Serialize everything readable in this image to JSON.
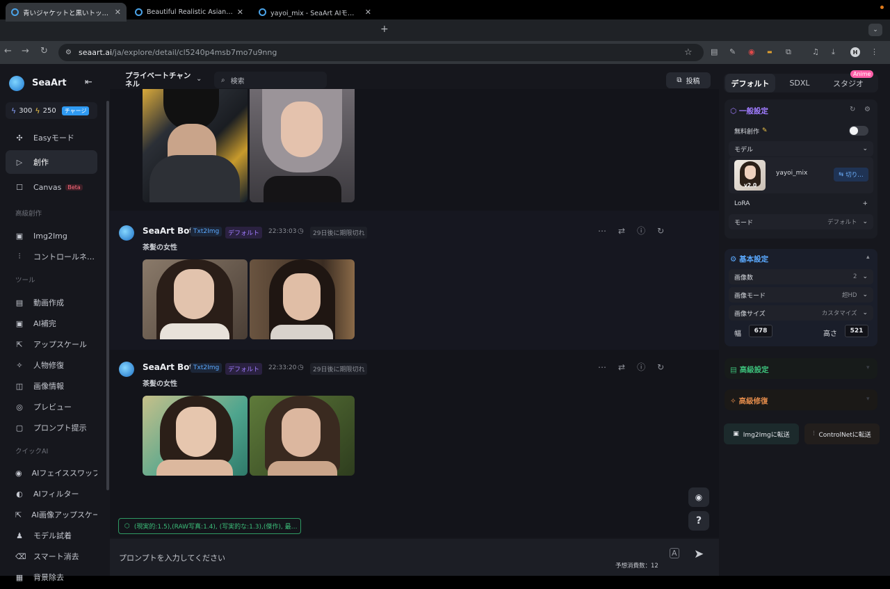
{
  "browser": {
    "tabs": [
      {
        "title": "青いジャケットと黒いトップスを…",
        "active": true
      },
      {
        "title": "Beautiful Realistic Asians - Se…",
        "active": false
      },
      {
        "title": "yayoi_mix - SeaArt AIモデル",
        "active": false
      }
    ],
    "url_domain": "seaart.ai",
    "url_path": "/ja/explore/detail/cl5240p4msb7mo7u9nng",
    "new_tab": "+",
    "profile_initial": "H"
  },
  "sidebar": {
    "brand": "SeaArt",
    "credits": {
      "a": "300",
      "b": "250",
      "charge": "チャージ"
    },
    "items_top": [
      {
        "label": "Easyモード",
        "icon": "✣",
        "name": "sidebar-item-easy-mode"
      },
      {
        "label": "創作",
        "icon": "▷",
        "name": "sidebar-item-create",
        "active": true
      },
      {
        "label": "Canvas",
        "icon": "☐",
        "name": "sidebar-item-canvas",
        "badge": "Beta"
      }
    ],
    "section_advanced": "高級創作",
    "items_advanced": [
      {
        "label": "Img2Img",
        "icon": "▣",
        "name": "sidebar-item-img2img"
      },
      {
        "label": "コントロールネ…",
        "icon": "⫶",
        "name": "sidebar-item-controlnet"
      }
    ],
    "section_tools": "ツール",
    "items_tools": [
      {
        "label": "動画作成",
        "icon": "▤",
        "name": "sidebar-item-video"
      },
      {
        "label": "AI補完",
        "icon": "▣",
        "name": "sidebar-item-ai-complete"
      },
      {
        "label": "アップスケール",
        "icon": "⇱",
        "name": "sidebar-item-upscale"
      },
      {
        "label": "人物修復",
        "icon": "✧",
        "name": "sidebar-item-face-fix"
      },
      {
        "label": "画像情報",
        "icon": "◫",
        "name": "sidebar-item-image-info"
      },
      {
        "label": "プレビュー",
        "icon": "◎",
        "name": "sidebar-item-preview"
      },
      {
        "label": "プロンプト提示",
        "icon": "▢",
        "name": "sidebar-item-prompt-hint"
      }
    ],
    "section_quick": "クイックAI",
    "items_quick": [
      {
        "label": "AIフェイススワップ",
        "icon": "◉",
        "name": "sidebar-item-faceswap"
      },
      {
        "label": "AIフィルター",
        "icon": "◐",
        "name": "sidebar-item-filter"
      },
      {
        "label": "AI画像アップスケーラ",
        "icon": "⇱",
        "name": "sidebar-item-ai-upscaler"
      },
      {
        "label": "モデル試着",
        "icon": "♟",
        "name": "sidebar-item-try-on"
      },
      {
        "label": "スマート消去",
        "icon": "⌫",
        "name": "sidebar-item-smart-erase"
      },
      {
        "label": "背景除去",
        "icon": "▦",
        "name": "sidebar-item-bg-remove"
      }
    ]
  },
  "topnav": {
    "channel": "プライベートチャンネル",
    "search_placeholder": "検索",
    "post_button": "投稿"
  },
  "posts": [
    {
      "bot": "SeaArt Bot",
      "tag1": "Txt2Img",
      "tag2": "デフォルト",
      "time": "22:33:03",
      "expire": "29日後に期限切れ",
      "prompt": "茶髪の女性"
    },
    {
      "bot": "SeaArt Bot",
      "tag1": "Txt2Img",
      "tag2": "デフォルト",
      "time": "22:33:20",
      "expire": "29日後に期限切れ",
      "prompt": "茶髪の女性"
    }
  ],
  "composer": {
    "tag_prompt": "(現実的:1.5),(RAW写真:1.4), (写実的な:1.3),(傑作), 最…",
    "placeholder": "プロンプトを入力してください",
    "cost": "予想消費数：12",
    "help": "?"
  },
  "panel": {
    "tabs": [
      "デフォルト",
      "SDXL",
      "スタジオ"
    ],
    "anime_badge": "Anime",
    "general": {
      "title": "一般設定",
      "free_label": "無料創作",
      "model_label": "モデル",
      "model_name": "yayoi_mix",
      "model_version": "v2.0",
      "switch": "切り…",
      "lora_label": "LoRA",
      "mode_label": "モード",
      "mode_value": "デフォルト"
    },
    "basic": {
      "title": "基本設定",
      "count_label": "画像数",
      "count_value": "2",
      "quality_label": "画像モード",
      "quality_value": "超HD",
      "size_label": "画像サイズ",
      "size_value": "カスタマイズ",
      "width_label": "幅",
      "width_value": "678",
      "height_label": "高さ",
      "height_value": "521"
    },
    "advanced_title": "高級設定",
    "repair_title": "高級修復",
    "btn_img2img": "Img2Imgに転送",
    "btn_controlnet": "ControlNetに転送"
  },
  "colors": {
    "accent_blue": "#2f9af2",
    "purple": "#a07cff",
    "green": "#3cbf7a",
    "orange": "#e08a4a"
  }
}
